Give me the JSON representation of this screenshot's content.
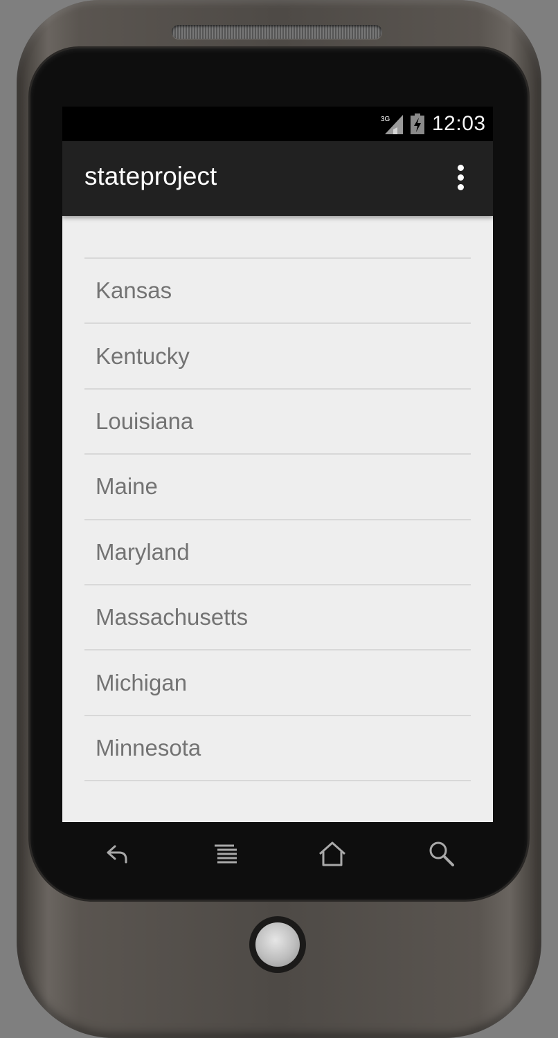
{
  "status_bar": {
    "network_label": "3G",
    "time": "12:03"
  },
  "action_bar": {
    "title": "stateproject",
    "overflow_icon": "overflow-menu-icon"
  },
  "list": {
    "items": [
      "Kansas",
      "Kentucky",
      "Louisiana",
      "Maine",
      "Maryland",
      "Massachusetts",
      "Michigan",
      "Minnesota"
    ]
  },
  "nav": {
    "buttons": [
      "back-icon",
      "menu-icon",
      "home-icon",
      "search-icon"
    ]
  },
  "colors": {
    "screen_background": "#eeeeee",
    "action_bar": "#212121",
    "list_text": "#737373",
    "divider": "#d8d8d8"
  }
}
